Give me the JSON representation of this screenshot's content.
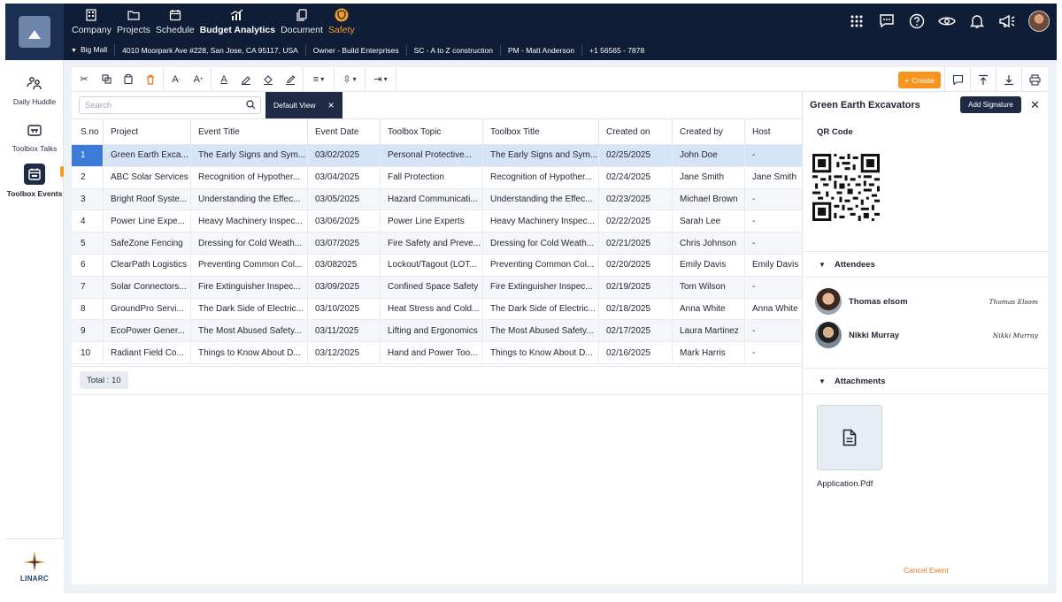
{
  "topnav": {
    "items": [
      {
        "label": "Company",
        "icon": "building-icon"
      },
      {
        "label": "Projects",
        "icon": "folder-icon"
      },
      {
        "label": "Schedule",
        "icon": "calendar-icon"
      },
      {
        "label": "Budget Analytics",
        "icon": "analytics-icon"
      },
      {
        "label": "Document",
        "icon": "document-icon"
      },
      {
        "label": "Safety",
        "icon": "shield-icon"
      }
    ],
    "right_icons": [
      "apps-grid-icon",
      "chat-icon",
      "help-icon",
      "eye-icon",
      "bell-icon",
      "megaphone-icon",
      "user-avatar"
    ]
  },
  "subbar": {
    "project": "Big Mall",
    "address": "4010 Moorpark Ave #228, San Jose, CA 95117, USA",
    "owner": "Owner - Build Enterprises",
    "sc": "SC - A to Z construction",
    "pm": "PM - Matt Anderson",
    "phone": "+1 56565 - 7878"
  },
  "sidebar": {
    "items": [
      {
        "label": "Daily Huddle",
        "icon": "huddle-icon"
      },
      {
        "label": "Toolbox Talks",
        "icon": "toolbox-icon"
      },
      {
        "label": "Toolbox Events",
        "icon": "calendar-event-icon"
      }
    ],
    "brand": "LINARC"
  },
  "toolbar": {
    "create_label": "Create"
  },
  "search": {
    "placeholder": "Search"
  },
  "view": {
    "label": "Default View"
  },
  "table": {
    "headers": [
      "S.no",
      "Project",
      "Event Title",
      "Event Date",
      "Toolbox Topic",
      "Toolbox Title",
      "Created on",
      "Created by",
      "Host"
    ],
    "rows": [
      [
        "1",
        "Green Earth Exca...",
        "The Early Signs and Sym...",
        "03/02/2025",
        "Personal Protective...",
        "The Early Signs and Sym...",
        "02/25/2025",
        "John Doe",
        "-"
      ],
      [
        "2",
        "ABC Solar Services",
        "Recognition of Hypother...",
        "03/04/2025",
        "Fall Protection",
        "Recognition of Hypother...",
        "02/24/2025",
        "Jane Smith",
        "Jane Smith"
      ],
      [
        "3",
        "Bright Roof Syste...",
        "Understanding the Effec...",
        "03/05/2025",
        "Hazard Communicati...",
        "Understanding the Effec...",
        "02/23/2025",
        "Michael Brown",
        "-"
      ],
      [
        "4",
        "Power Line Expe...",
        "Heavy Machinery Inspec...",
        "03/06/2025",
        "Power Line Experts",
        "Heavy Machinery Inspec...",
        "02/22/2025",
        "Sarah Lee",
        "-"
      ],
      [
        "5",
        "SafeZone Fencing",
        "Dressing for Cold Weath...",
        "03/07/2025",
        "Fire Safety and Preve...",
        "Dressing for Cold Weath...",
        "02/21/2025",
        "Chris Johnson",
        "-"
      ],
      [
        "6",
        "ClearPath Logistics",
        "Preventing Common Col...",
        "03/082025",
        "Lockout/Tagout (LOT...",
        "Preventing Common Col...",
        "02/20/2025",
        "Emily Davis",
        "Emily Davis"
      ],
      [
        "7",
        "Solar Connectors...",
        "Fire Extinguisher Inspec...",
        "03/09/2025",
        "Confined Space Safety",
        "Fire Extinguisher Inspec...",
        "02/19/2025",
        "Tom Wilson",
        "-"
      ],
      [
        "8",
        "GroundPro Servi...",
        "The Dark Side of Electric...",
        "03/10/2025",
        "Heat Stress and Cold...",
        "The Dark Side of Electric...",
        "02/18/2025",
        "Anna White",
        "Anna White"
      ],
      [
        "9",
        "EcoPower Gener...",
        "The Most Abused Safety...",
        "03/11/2025",
        "Lifting and Ergonomics",
        "The Most Abused Safety...",
        "02/17/2025",
        "Laura Martinez",
        "-"
      ],
      [
        "10",
        "Radiant Field Co...",
        "Things to Know About D...",
        "03/12/2025",
        "Hand and Power Too...",
        "Things to Know About D...",
        "02/16/2025",
        "Mark Harris",
        "-"
      ]
    ],
    "total": "Total : 10"
  },
  "panel": {
    "title": "Green Earth Excavators",
    "add_signature": "Add Signature",
    "qr_label": "QR Code",
    "attendees_label": "Attendees",
    "attendees": [
      {
        "name": "Thomas elsom",
        "signature": "Thomas Elsom"
      },
      {
        "name": "Nikki Murray",
        "signature": "Nikki Murray"
      }
    ],
    "attachments_label": "Attachments",
    "file_name": "Application.Pdf",
    "cancel_label": "Cancel Event"
  },
  "colors": {
    "nav_bg": "#0f1d36",
    "accent": "#f7941d",
    "selected_row": "#d6e4f7",
    "selected_sno": "#3d7bd9"
  }
}
